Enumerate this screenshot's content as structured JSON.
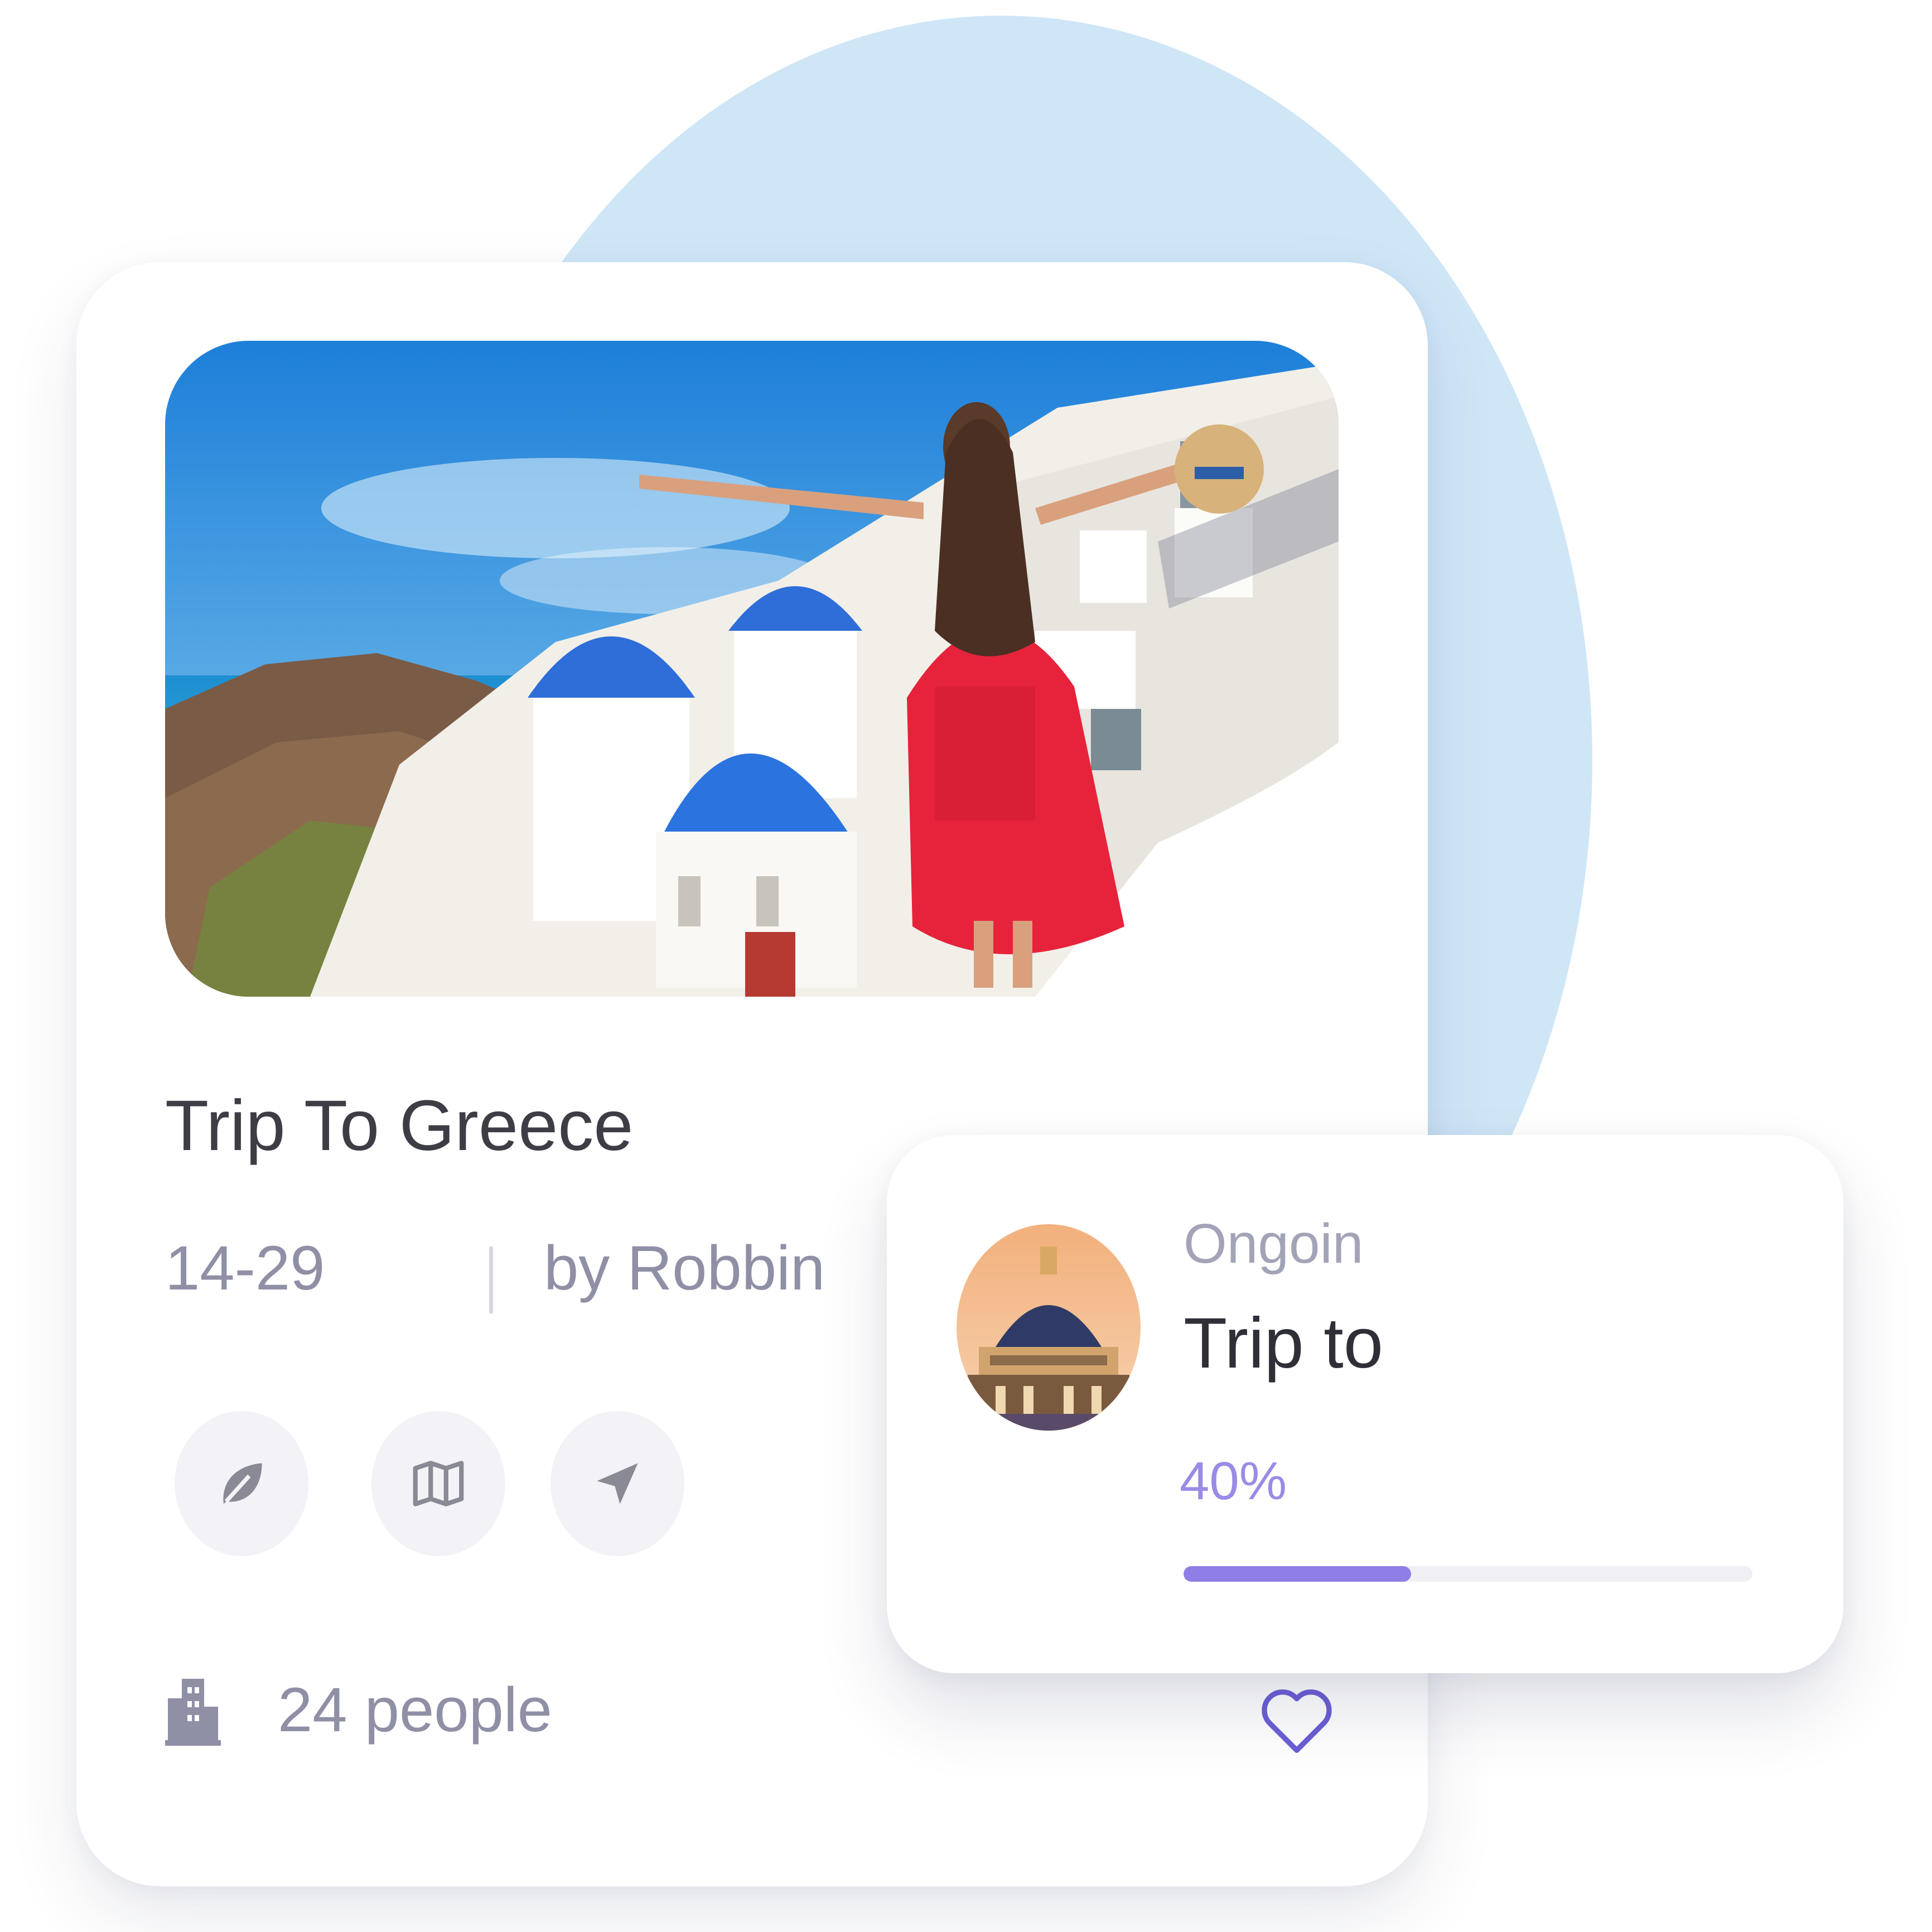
{
  "trip_card": {
    "title": "Trip To Greece",
    "dates": "14-29",
    "author": "by Robbin",
    "people": "24 people",
    "icons": [
      "leaf-icon",
      "map-icon",
      "location-arrow-icon"
    ]
  },
  "ongoing_card": {
    "status": "Ongoin",
    "title": "Trip to",
    "progress_label": "40%",
    "progress": 0.4
  },
  "colors": {
    "accent": "#8f7ee6",
    "background_circle": "#cfe6f7",
    "muted_text": "#8f8fa6"
  }
}
